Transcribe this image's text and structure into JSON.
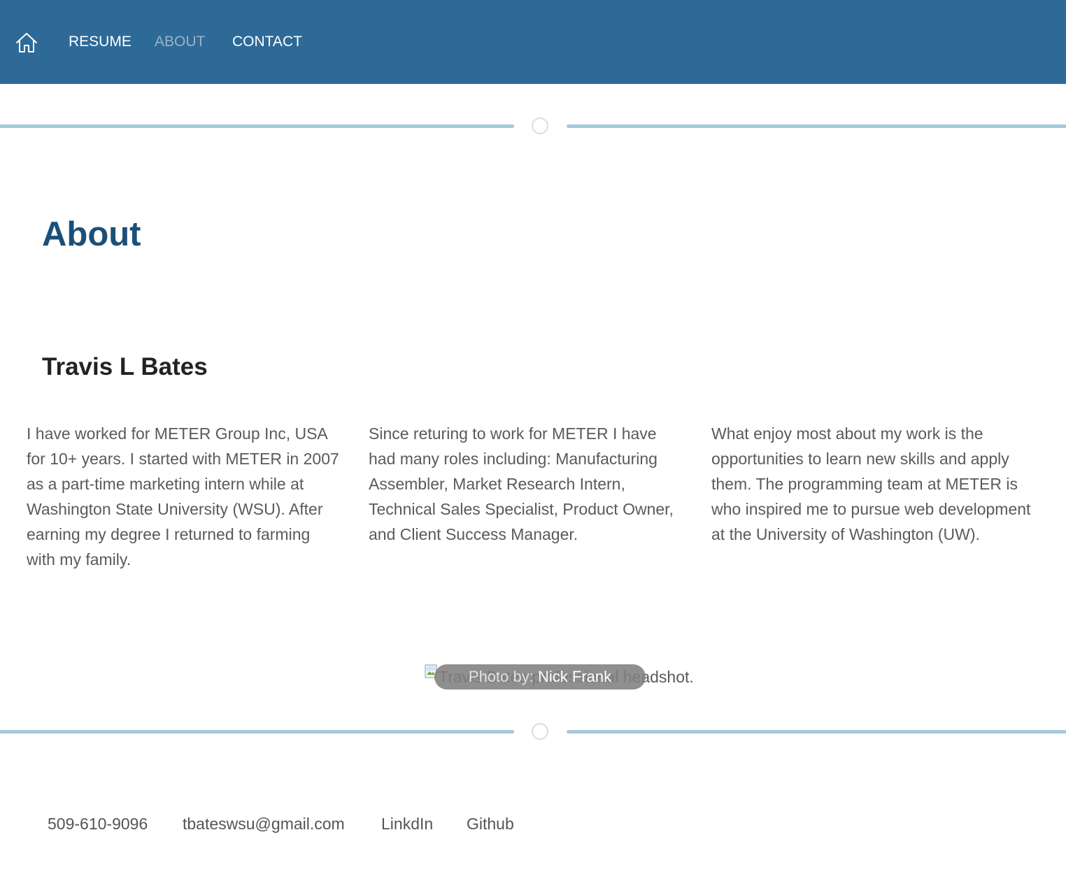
{
  "nav": {
    "home_icon": "home-icon",
    "items": [
      {
        "label": "RESUME"
      },
      {
        "label": "ABOUT",
        "active": true
      },
      {
        "label": "CONTACT"
      }
    ]
  },
  "main": {
    "title": "About",
    "name": "Travis L Bates",
    "paragraphs": [
      "I have worked for METER Group Inc, USA for 10+ years. I started with METER in 2007 as a part-time marketing intern while at Washington State University (WSU). After earning my degree I returned to farming with my family.",
      "Since returing to work for METER I have had many roles including: Manufacturing Assembler, Market Research Intern, Technical Sales Specialist, Product Owner, and Client Success Manager.",
      "What enjoy most about my work is the opportunities to learn new skills and apply them. The programming team at METER is who inspired me to pursue web development at the University of Washington (UW)."
    ],
    "photo": {
      "alt_text": "Travis Bates professional headshot.",
      "caption_prefix": "Photo by:",
      "caption_name": "Nick Frank"
    }
  },
  "footer": {
    "phone": "509-610-9096",
    "email": "tbateswsu@gmail.com",
    "linkedin": "LinkdIn",
    "github": "Github"
  },
  "colors": {
    "nav_bg": "#2d6a97",
    "nav_active": "#9db3c6",
    "divider": "#a6c8df",
    "title": "#1c4f78"
  }
}
